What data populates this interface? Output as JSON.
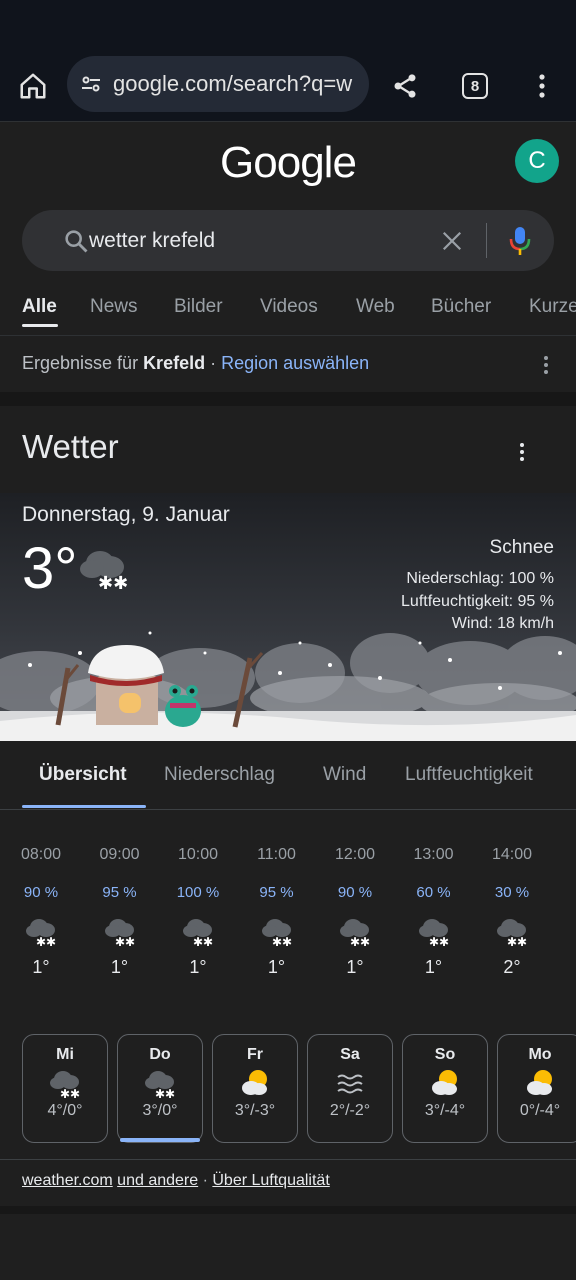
{
  "browser": {
    "url": "google.com/search?q=w",
    "tab_count": "8"
  },
  "google": {
    "logo": "Google",
    "avatar_letter": "C",
    "query": "wetter krefeld"
  },
  "tabs": [
    "Alle",
    "News",
    "Bilder",
    "Videos",
    "Web",
    "Bücher",
    "Kurze"
  ],
  "region": {
    "prefix": "Ergebnisse für ",
    "place": "Krefeld",
    "separator": " · ",
    "link": "Region auswählen"
  },
  "weather": {
    "title": "Wetter",
    "date": "Donnerstag, 9. Januar",
    "temp": "3°",
    "condition": "Schnee",
    "precipitation": "Niederschlag: 100 %",
    "humidity": "Luftfeuchtigkeit: 95 %",
    "wind": "Wind: 18 km/h",
    "subtabs": [
      "Übersicht",
      "Niederschlag",
      "Wind",
      "Luftfeuchtigkeit"
    ],
    "hourly": [
      {
        "time": "08:00",
        "precip": "90 %",
        "temp": "1°",
        "icon": "snow-cloud-icon"
      },
      {
        "time": "09:00",
        "precip": "95 %",
        "temp": "1°",
        "icon": "snow-cloud-icon"
      },
      {
        "time": "10:00",
        "precip": "100 %",
        "temp": "1°",
        "icon": "snow-cloud-icon"
      },
      {
        "time": "11:00",
        "precip": "95 %",
        "temp": "1°",
        "icon": "snow-cloud-icon"
      },
      {
        "time": "12:00",
        "precip": "90 %",
        "temp": "1°",
        "icon": "snow-cloud-icon"
      },
      {
        "time": "13:00",
        "precip": "60 %",
        "temp": "1°",
        "icon": "snow-cloud-icon"
      },
      {
        "time": "14:00",
        "precip": "30 %",
        "temp": "2°",
        "icon": "snow-cloud-icon"
      }
    ],
    "daily": [
      {
        "day": "Mi",
        "temps": "4°/0°",
        "icon": "snow-cloud-icon"
      },
      {
        "day": "Do",
        "temps": "3°/0°",
        "icon": "snow-cloud-icon"
      },
      {
        "day": "Fr",
        "temps": "3°/-3°",
        "icon": "partly-sunny-icon"
      },
      {
        "day": "Sa",
        "temps": "2°/-2°",
        "icon": "fog-icon"
      },
      {
        "day": "So",
        "temps": "3°/-4°",
        "icon": "partly-sunny-icon"
      },
      {
        "day": "Mo",
        "temps": "0°/-4°",
        "icon": "partly-sunny-icon"
      }
    ],
    "source_link": "weather.com",
    "others_link": "und andere",
    "dot": " · ",
    "air_link": "Über Luftqualität"
  },
  "colors": {
    "accent": "#8ab4f8",
    "background": "#1f1f1f",
    "avatar": "#12a48b"
  }
}
